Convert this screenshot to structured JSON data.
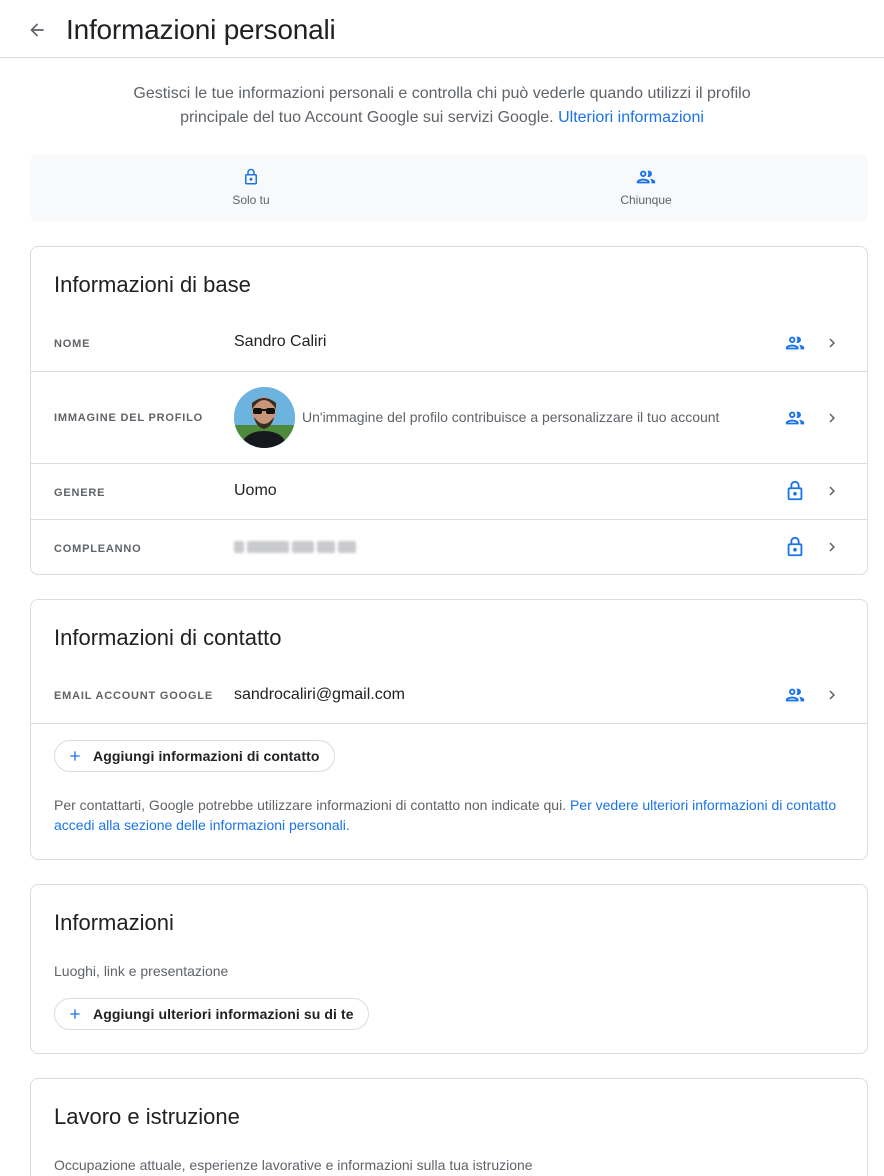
{
  "header": {
    "title": "Informazioni personali",
    "back_icon": "arrow-back-icon"
  },
  "intro": {
    "text": "Gestisci le tue informazioni personali e controlla chi può vederle quando utilizzi il profilo principale del tuo Account Google sui servizi Google.",
    "link": "Ulteriori informazioni"
  },
  "legend": {
    "items": [
      {
        "icon": "lock-icon",
        "label": "Solo tu"
      },
      {
        "icon": "people-icon",
        "label": "Chiunque"
      }
    ]
  },
  "basic_info": {
    "title": "Informazioni di base",
    "rows": [
      {
        "label": "Nome",
        "value": "Sandro Caliri",
        "visibility": "people-icon"
      },
      {
        "label": "Immagine del profilo",
        "value": "Un'immagine del profilo contribuisce a personalizzare il tuo account",
        "visibility": "people-icon"
      },
      {
        "label": "Genere",
        "value": "Uomo",
        "visibility": "lock-icon"
      },
      {
        "label": "Compleanno",
        "value": "",
        "visibility": "lock-icon"
      }
    ]
  },
  "contact_info": {
    "title": "Informazioni di contatto",
    "rows": [
      {
        "label": "Email account Google",
        "value": "sandrocaliri@gmail.com",
        "visibility": "people-icon"
      }
    ],
    "add_button": "Aggiungi informazioni di contatto",
    "note_text": "Per contattarti, Google potrebbe utilizzare informazioni di contatto non indicate qui.",
    "note_link": "Per vedere ulteriori informazioni di contatto accedi alla sezione delle informazioni personali."
  },
  "about": {
    "title": "Informazioni",
    "subtext": "Luoghi, link e presentazione",
    "add_button": "Aggiungi ulteriori informazioni su di te"
  },
  "work": {
    "title": "Lavoro e istruzione",
    "subtext": "Occupazione attuale, esperienze lavorative e informazioni sulla tua istruzione"
  },
  "colors": {
    "accent": "#1a73e8",
    "text_primary": "#202124",
    "text_secondary": "#5f6368",
    "border": "#dadce0",
    "legend_bg": "#f8f9fa"
  }
}
